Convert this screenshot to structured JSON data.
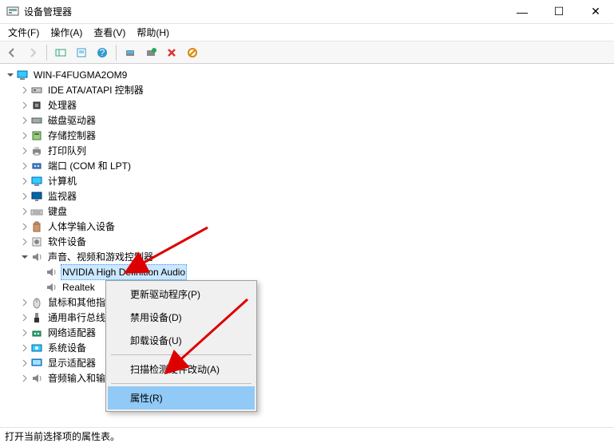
{
  "window": {
    "title": "设备管理器",
    "controls": {
      "min": "—",
      "max": "☐",
      "close": "✕"
    }
  },
  "menu": {
    "file": "文件(F)",
    "action": "操作(A)",
    "view": "查看(V)",
    "help": "帮助(H)"
  },
  "tree": {
    "root": "WIN-F4FUGMA2OM9",
    "items": [
      {
        "label": "IDE ATA/ATAPI 控制器",
        "icon": "ide"
      },
      {
        "label": "处理器",
        "icon": "cpu"
      },
      {
        "label": "磁盘驱动器",
        "icon": "disk"
      },
      {
        "label": "存储控制器",
        "icon": "storage"
      },
      {
        "label": "打印队列",
        "icon": "printer"
      },
      {
        "label": "端口 (COM 和 LPT)",
        "icon": "port"
      },
      {
        "label": "计算机",
        "icon": "computer"
      },
      {
        "label": "监视器",
        "icon": "monitor"
      },
      {
        "label": "键盘",
        "icon": "keyboard"
      },
      {
        "label": "人体学输入设备",
        "icon": "hid"
      },
      {
        "label": "软件设备",
        "icon": "software"
      },
      {
        "label": "声音、视频和游戏控制器",
        "icon": "sound",
        "expanded": true,
        "children": [
          {
            "label": "NVIDIA High Definition Audio",
            "icon": "speaker",
            "selected": true
          },
          {
            "label": "Realtek",
            "icon": "speaker"
          }
        ]
      },
      {
        "label": "鼠标和其他指",
        "icon": "mouse"
      },
      {
        "label": "通用串行总线",
        "icon": "usb"
      },
      {
        "label": "网络适配器",
        "icon": "network"
      },
      {
        "label": "系统设备",
        "icon": "system"
      },
      {
        "label": "显示适配器",
        "icon": "display"
      },
      {
        "label": "音频输入和输出",
        "icon": "speaker"
      }
    ]
  },
  "context_menu": {
    "update": "更新驱动程序(P)",
    "disable": "禁用设备(D)",
    "uninstall": "卸载设备(U)",
    "scan": "扫描检测硬件改动(A)",
    "properties": "属性(R)"
  },
  "status": "打开当前选择项的属性表。"
}
